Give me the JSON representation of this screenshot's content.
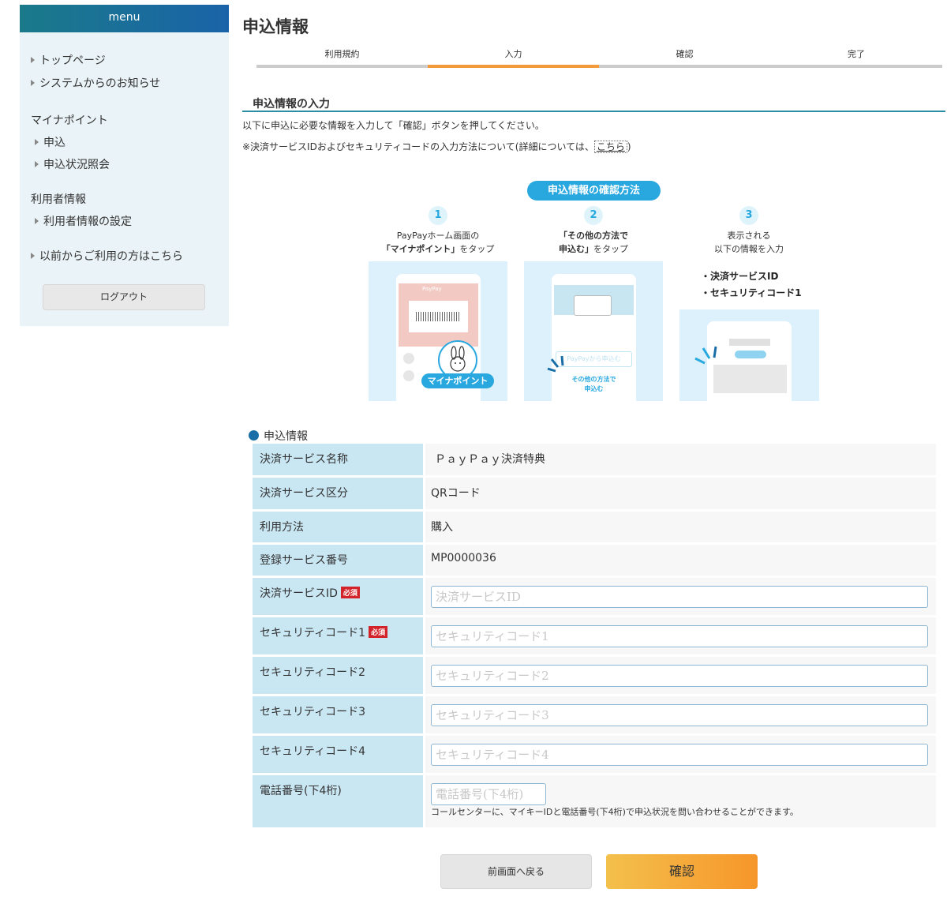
{
  "sidebar": {
    "header": "menu",
    "links": {
      "top_page": "トップページ",
      "system_notice": "システムからのお知らせ",
      "apply": "申込",
      "apply_status": "申込状況照会",
      "user_settings": "利用者情報の設定",
      "previous_users": "以前からご利用の方はこちら"
    },
    "headings": {
      "my_point": "マイナポイント",
      "user_info": "利用者情報"
    },
    "logout": "ログアウト"
  },
  "main": {
    "title": "申込情報",
    "steps": [
      {
        "label": "利用規約",
        "active": false
      },
      {
        "label": "入力",
        "active": true
      },
      {
        "label": "確認",
        "active": false
      },
      {
        "label": "完了",
        "active": false
      }
    ],
    "section_title": "申込情報の入力",
    "intro_line1": "以下に申込に必要な情報を入力して「確認」ボタンを押してください。",
    "intro_line2_prefix": "※決済サービスIDおよびセキュリティコードの入力方法について(詳細については、",
    "intro_line2_link": "こちら",
    "intro_line2_suffix": ")"
  },
  "guide": {
    "title": "申込情報の確認方法",
    "steps": [
      {
        "num": "1",
        "line1": "PayPayホーム画面の",
        "line2_bold": "「マイナポイント」",
        "line2_rest": "をタップ"
      },
      {
        "num": "2",
        "line1_bold": "「その他の方法で",
        "line2_bold": "申込む」",
        "line2_rest": "をタップ"
      },
      {
        "num": "3",
        "line1": "表示される",
        "line2": "以下の情報を入力"
      }
    ],
    "bullets": [
      "・決済サービスID",
      "・セキュリティコード1"
    ],
    "panel1": {
      "app_label": "PayPay",
      "badge": "マイナポイント"
    },
    "panel2": {
      "ghost_button": "PayPayから申込む",
      "link_line1": "その他の方法で",
      "link_line2": "申込む"
    }
  },
  "info": {
    "heading": "申込情報",
    "required_badge": "必須",
    "rows": {
      "service_name": {
        "label": "決済サービス名称",
        "value": "ＰａｙＰａｙ決済特典"
      },
      "service_type": {
        "label": "決済サービス区分",
        "value": "QRコード"
      },
      "usage": {
        "label": "利用方法",
        "value": "購入"
      },
      "reg_number": {
        "label": "登録サービス番号",
        "value": "MP0000036"
      },
      "service_id": {
        "label": "決済サービスID",
        "placeholder": "決済サービスID",
        "value": ""
      },
      "sec1": {
        "label": "セキュリティコード1",
        "placeholder": "セキュリティコード1",
        "value": ""
      },
      "sec2": {
        "label": "セキュリティコード2",
        "placeholder": "セキュリティコード2",
        "value": ""
      },
      "sec3": {
        "label": "セキュリティコード3",
        "placeholder": "セキュリティコード3",
        "value": ""
      },
      "sec4": {
        "label": "セキュリティコード4",
        "placeholder": "セキュリティコード4",
        "value": ""
      },
      "phone": {
        "label": "電話番号(下4桁)",
        "placeholder": "電話番号(下4桁)",
        "value": "",
        "note": "コールセンターに、マイキーIDと電話番号(下4桁)で申込状況を問い合わせることができます。"
      }
    }
  },
  "buttons": {
    "back": "前画面へ戻る",
    "confirm": "確認"
  },
  "colors": {
    "header_start": "#1a7a8a",
    "header_end": "#1a63a8",
    "accent_orange": "#f39a3a",
    "guide_blue": "#29a8e0",
    "label_bg": "#c9e6f3",
    "required_red": "#d2232a"
  }
}
